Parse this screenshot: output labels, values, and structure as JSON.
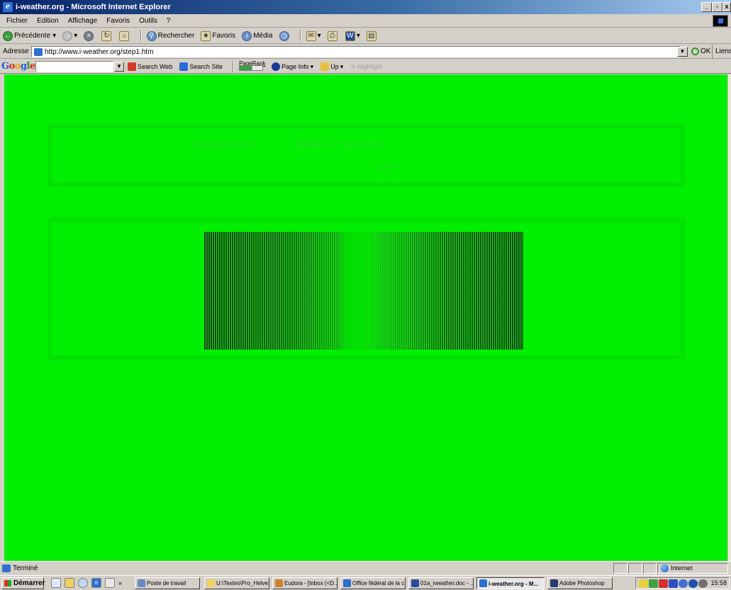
{
  "window": {
    "title": "i-weather.org - Microsoft Internet Explorer",
    "min": "_",
    "max": "▫",
    "close": "x"
  },
  "menu": [
    "Fichier",
    "Edition",
    "Affichage",
    "Favoris",
    "Outils",
    "?"
  ],
  "toolbar": {
    "back": "Précédente",
    "search": "Rechercher",
    "favorites": "Favoris",
    "media": "Média"
  },
  "address": {
    "label": "Adresse",
    "url": "http://www.i-weather.org/step1.htm",
    "go": "OK",
    "links": "Liens"
  },
  "googlebar": {
    "logo": "Google",
    "search_web": "Search Web",
    "search_site": "Search Site",
    "pagerank": "PageRank",
    "page_info": "Page Info",
    "up": "Up",
    "highlight": "Highlight"
  },
  "page": {
    "site_name": "i-weather.org",
    "dashes_1": "--------",
    "code": "000441 // 11:44:14",
    "dashes_2": "--------",
    "next": "next"
  },
  "status": {
    "text": "Terminé",
    "zone": "Internet"
  },
  "taskbar": {
    "start": "Démarrer",
    "tasks": [
      "Poste de travail",
      "U:\\Textes\\Pro_Helve...",
      "Eudora - [Inbox (<D...",
      "Office fédéral de la c...",
      "01a_iweather.doc - ...",
      "i-weather.org - M...",
      "Adobe Photoshop"
    ],
    "clock": "15:58"
  },
  "colors": {
    "page_background": "#00ee00",
    "text_accent": "#2fcf3a",
    "frame": "#02e102"
  }
}
